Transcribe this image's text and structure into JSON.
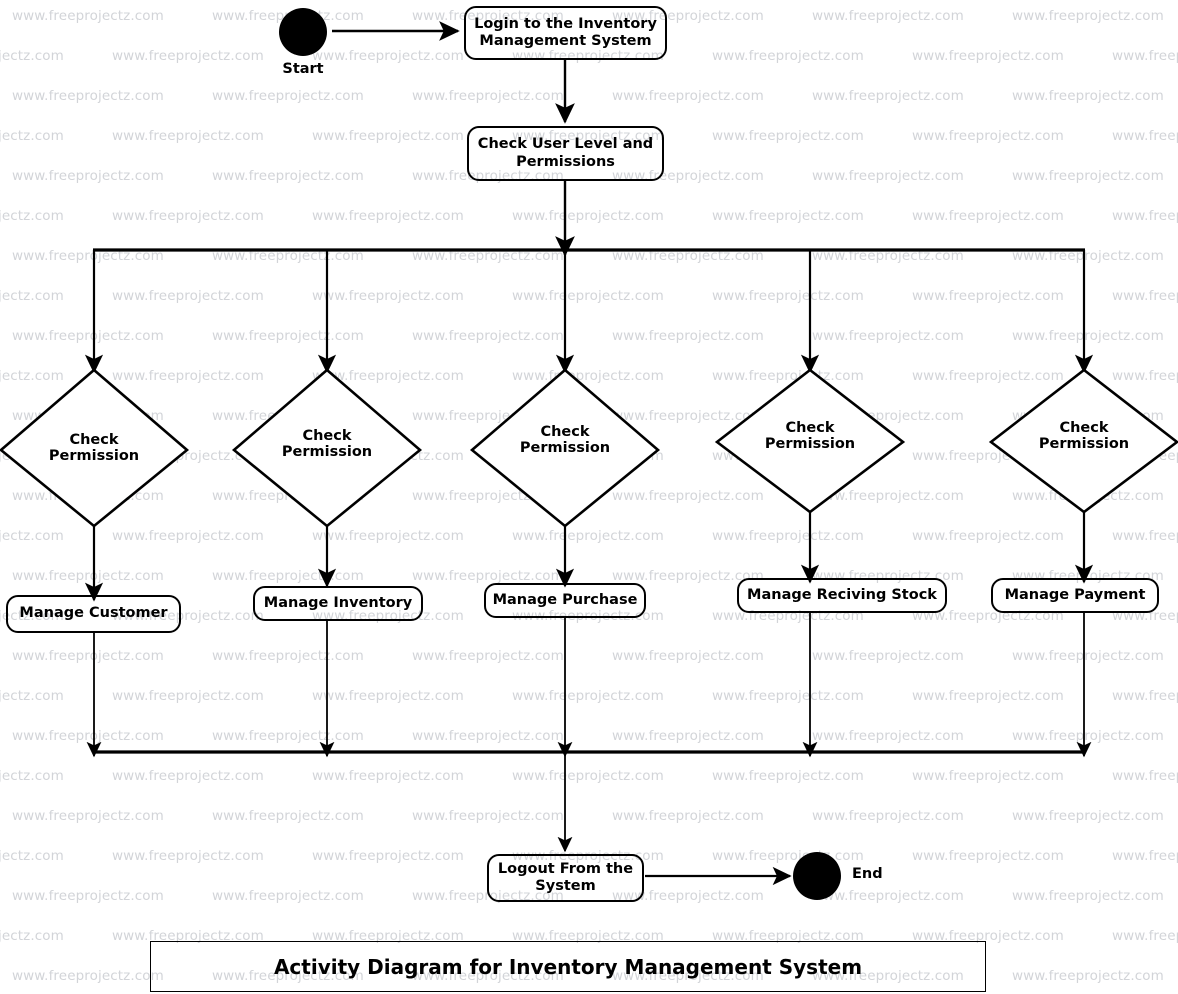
{
  "diagram": {
    "title": "Activity Diagram for Inventory Management System",
    "type": "uml-activity-diagram",
    "colors": {
      "stroke": "#000000",
      "fill": "#ffffff",
      "watermark": "#d2d4d8"
    },
    "watermark": {
      "text": "www.freeprojectz.com"
    },
    "start": {
      "label": "Start"
    },
    "end": {
      "label": "End"
    },
    "activities": {
      "login": "Login to the Inventory Management System",
      "check_user": "Check User Level and Permissions",
      "logout": "Logout From the System",
      "manage_customer": "Manage Customer",
      "manage_inventory": "Manage Inventory",
      "manage_purchase": "Manage Purchase",
      "manage_receiving_stock": "Manage Reciving Stock",
      "manage_payment": "Manage Payment"
    },
    "decisions": [
      {
        "line1": "Check",
        "line2": "Permission"
      },
      {
        "line1": "Check",
        "line2": "Permission"
      },
      {
        "line1": "Check",
        "line2": "Permission"
      },
      {
        "line1": "Check",
        "line2": "Permission"
      },
      {
        "line1": "Check",
        "line2": "Permission"
      }
    ],
    "branches": [
      {
        "decision": "Check Permission",
        "activity": "Manage Customer"
      },
      {
        "decision": "Check Permission",
        "activity": "Manage Inventory"
      },
      {
        "decision": "Check Permission",
        "activity": "Manage Purchase"
      },
      {
        "decision": "Check Permission",
        "activity": "Manage Reciving Stock"
      },
      {
        "decision": "Check Permission",
        "activity": "Manage Payment"
      }
    ],
    "flow": [
      "Start",
      "Login to the Inventory Management System",
      "Check User Level and Permissions",
      "Fork",
      "Check Permission",
      "Manage Customer / Manage Inventory / Manage Purchase / Manage Reciving Stock / Manage Payment",
      "Join",
      "Logout From the System",
      "End"
    ]
  }
}
